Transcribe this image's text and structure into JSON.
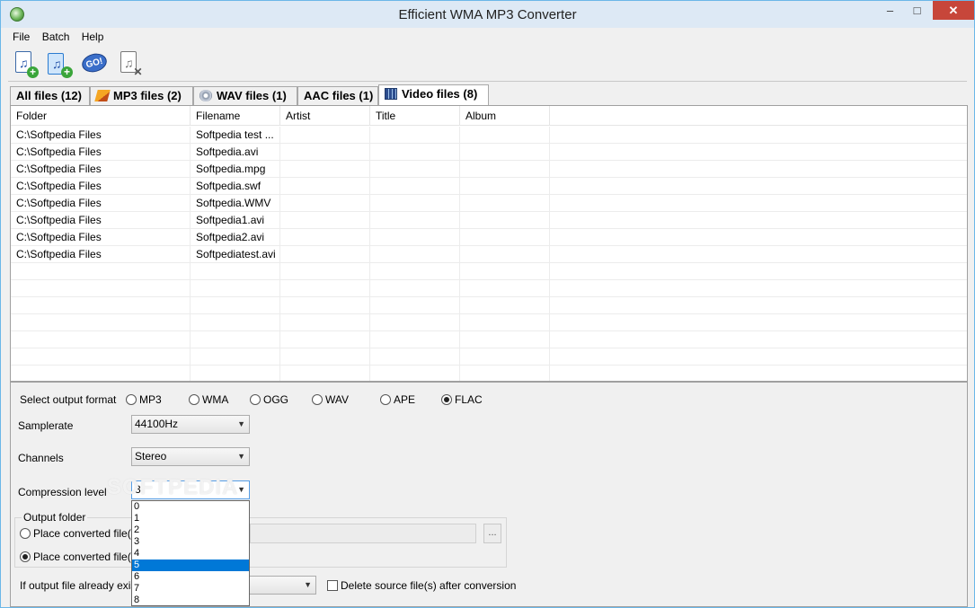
{
  "window": {
    "title": "Efficient WMA MP3 Converter",
    "min_glyph": "–",
    "max_glyph": "□",
    "close_glyph": "✕"
  },
  "menu": [
    "File",
    "Batch",
    "Help"
  ],
  "toolbar": {
    "add_files_icon": "add-files-icon",
    "add_folder_icon": "add-folder-icon",
    "convert_label": "GO!",
    "remove_icon": "remove-file-icon"
  },
  "tabs": [
    {
      "label": "All files (12)"
    },
    {
      "label": "MP3 files (2)"
    },
    {
      "label": "WAV files (1)"
    },
    {
      "label": "AAC files (1)"
    },
    {
      "label": "Video files (8)"
    }
  ],
  "list": {
    "columns": [
      "Folder",
      "Filename",
      "Artist",
      "Title",
      "Album"
    ],
    "rows": [
      [
        "C:\\Softpedia Files",
        "Softpedia test ...",
        "",
        "",
        ""
      ],
      [
        "C:\\Softpedia Files",
        "Softpedia.avi",
        "",
        "",
        ""
      ],
      [
        "C:\\Softpedia Files",
        "Softpedia.mpg",
        "",
        "",
        ""
      ],
      [
        "C:\\Softpedia Files",
        "Softpedia.swf",
        "",
        "",
        ""
      ],
      [
        "C:\\Softpedia Files",
        "Softpedia.WMV",
        "",
        "",
        ""
      ],
      [
        "C:\\Softpedia Files",
        "Softpedia1.avi",
        "",
        "",
        ""
      ],
      [
        "C:\\Softpedia Files",
        "Softpedia2.avi",
        "",
        "",
        ""
      ],
      [
        "C:\\Softpedia Files",
        "Softpediatest.avi",
        "",
        "",
        ""
      ]
    ]
  },
  "settings": {
    "format_label": "Select output format",
    "formats": [
      "MP3",
      "WMA",
      "OGG",
      "WAV",
      "APE",
      "FLAC"
    ],
    "selected_format": "FLAC",
    "samplerate_label": "Samplerate",
    "samplerate_value": "44100Hz",
    "channels_label": "Channels",
    "channels_value": "Stereo",
    "compression_label": "Compression level",
    "compression_value": "3",
    "compression_options": [
      "0",
      "1",
      "2",
      "3",
      "4",
      "5",
      "6",
      "7",
      "8"
    ],
    "compression_highlight": "5",
    "output_folder_label": "Output folder",
    "place_option_1": "Place converted file(s)",
    "place_option_2": "Place converted file(s)",
    "browse_label": "...",
    "exists_label": "If output file already exist",
    "delete_label": "Delete source file(s) after conversion"
  },
  "watermark": "SOFTPEDIA"
}
